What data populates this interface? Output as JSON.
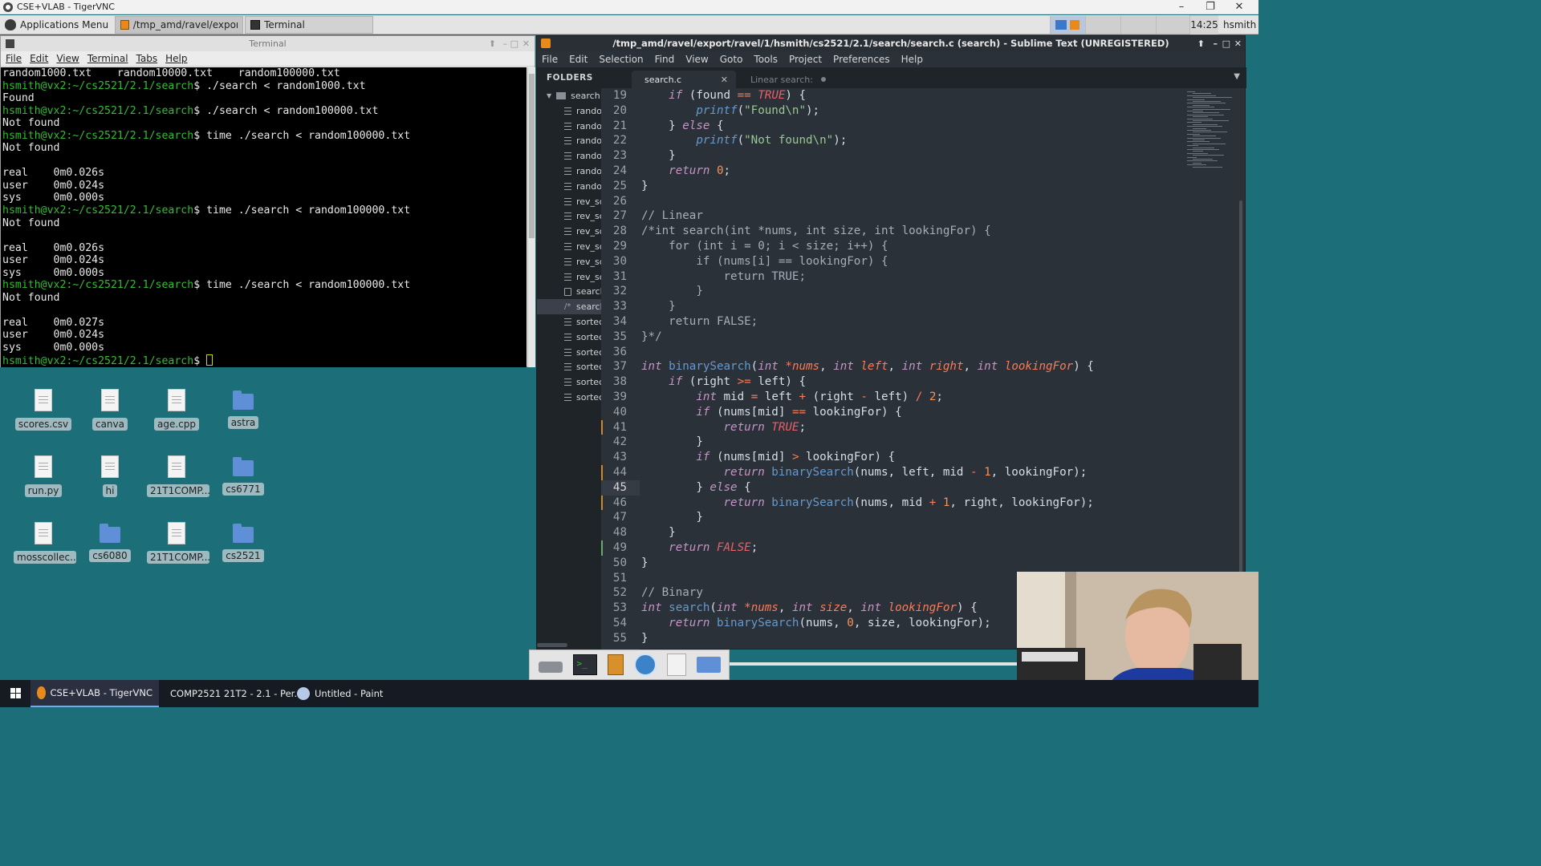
{
  "vnc": {
    "title": "CSE+VLAB - TigerVNC",
    "min": "–",
    "max": "❐",
    "close": "✕"
  },
  "panel": {
    "apps_menu": "Applications Menu",
    "tasks": [
      "/tmp_amd/ravel/export...",
      "Terminal"
    ],
    "clock": "14:25",
    "user": "hsmith"
  },
  "terminal": {
    "title": "Terminal",
    "menu": [
      "File",
      "Edit",
      "View",
      "Terminal",
      "Tabs",
      "Help"
    ],
    "lines": [
      {
        "t": "out",
        "text": "random1000.txt    random10000.txt    random100000.txt"
      },
      {
        "t": "cmd",
        "prompt": "hsmith@vx2:~/cs2521/2.1/search",
        "text": "$ ./search < random1000.txt"
      },
      {
        "t": "out",
        "text": "Found"
      },
      {
        "t": "cmd",
        "prompt": "hsmith@vx2:~/cs2521/2.1/search",
        "text": "$ ./search < random100000.txt"
      },
      {
        "t": "out",
        "text": "Not found"
      },
      {
        "t": "cmd",
        "prompt": "hsmith@vx2:~/cs2521/2.1/search",
        "text": "$ time ./search < random100000.txt"
      },
      {
        "t": "out",
        "text": "Not found"
      },
      {
        "t": "out",
        "text": ""
      },
      {
        "t": "out",
        "text": "real    0m0.026s"
      },
      {
        "t": "out",
        "text": "user    0m0.024s"
      },
      {
        "t": "out",
        "text": "sys     0m0.000s"
      },
      {
        "t": "cmd",
        "prompt": "hsmith@vx2:~/cs2521/2.1/search",
        "text": "$ time ./search < random100000.txt"
      },
      {
        "t": "out",
        "text": "Not found"
      },
      {
        "t": "out",
        "text": ""
      },
      {
        "t": "out",
        "text": "real    0m0.026s"
      },
      {
        "t": "out",
        "text": "user    0m0.024s"
      },
      {
        "t": "out",
        "text": "sys     0m0.000s"
      },
      {
        "t": "cmd",
        "prompt": "hsmith@vx2:~/cs2521/2.1/search",
        "text": "$ time ./search < random100000.txt"
      },
      {
        "t": "out",
        "text": "Not found"
      },
      {
        "t": "out",
        "text": ""
      },
      {
        "t": "out",
        "text": "real    0m0.027s"
      },
      {
        "t": "out",
        "text": "user    0m0.024s"
      },
      {
        "t": "out",
        "text": "sys     0m0.000s"
      },
      {
        "t": "cmd",
        "prompt": "hsmith@vx2:~/cs2521/2.1/search",
        "text": "$ ",
        "cursor": true
      }
    ]
  },
  "desktop": {
    "icons": [
      {
        "label": "scores.csv",
        "kind": "file"
      },
      {
        "label": "canva",
        "kind": "file"
      },
      {
        "label": "age.cpp",
        "kind": "file"
      },
      {
        "label": "astra",
        "kind": "folder"
      },
      {
        "label": "run.py",
        "kind": "file"
      },
      {
        "label": "hi",
        "kind": "file"
      },
      {
        "label": "21T1COMP...",
        "kind": "file"
      },
      {
        "label": "cs6771",
        "kind": "folder"
      },
      {
        "label": "mosscollec...",
        "kind": "file"
      },
      {
        "label": "cs6080",
        "kind": "folder"
      },
      {
        "label": "21T1COMP...",
        "kind": "file"
      },
      {
        "label": "cs2521",
        "kind": "folder"
      }
    ]
  },
  "sublime": {
    "title": "/tmp_amd/ravel/export/ravel/1/hsmith/cs2521/2.1/search/search.c (search) - Sublime Text (UNREGISTERED)",
    "menu": [
      "File",
      "Edit",
      "Selection",
      "Find",
      "View",
      "Goto",
      "Tools",
      "Project",
      "Preferences",
      "Help"
    ],
    "sidebar_header": "FOLDERS",
    "sidebar_arrows": "◀ ▶",
    "folder": "search",
    "files": [
      {
        "name": "rando",
        "icon": "lines"
      },
      {
        "name": "rando",
        "icon": "lines"
      },
      {
        "name": "rando",
        "icon": "lines"
      },
      {
        "name": "rando",
        "icon": "lines"
      },
      {
        "name": "rando",
        "icon": "lines"
      },
      {
        "name": "rando",
        "icon": "lines"
      },
      {
        "name": "rev_sc",
        "icon": "lines"
      },
      {
        "name": "rev_sc",
        "icon": "lines"
      },
      {
        "name": "rev_sc",
        "icon": "lines"
      },
      {
        "name": "rev_sc",
        "icon": "lines"
      },
      {
        "name": "rev_sc",
        "icon": "lines"
      },
      {
        "name": "rev_sc",
        "icon": "lines"
      },
      {
        "name": "searcl",
        "icon": "doc"
      },
      {
        "name": "searcl",
        "icon": "code",
        "selected": true
      },
      {
        "name": "sortec",
        "icon": "lines"
      },
      {
        "name": "sortec",
        "icon": "lines"
      },
      {
        "name": "sortec",
        "icon": "lines"
      },
      {
        "name": "sortec",
        "icon": "lines"
      },
      {
        "name": "sortec",
        "icon": "lines"
      },
      {
        "name": "sortec",
        "icon": "lines"
      }
    ],
    "tabs": [
      {
        "label": "search.c",
        "close": "✕",
        "active": true
      },
      {
        "label": "Linear search:",
        "active": false
      }
    ],
    "current_line": 45,
    "git_marks": {
      "41": "#c98a2e",
      "44": "#c98a2e",
      "46": "#c98a2e",
      "49": "#6aa96a"
    },
    "code_lines": [
      {
        "n": 19,
        "h": "    <span class=\"kw\">if</span> (found <span class=\"op\">==</span> <span class=\"cst\">TRUE</span>) {"
      },
      {
        "n": 20,
        "h": "        <span class=\"fnit\">printf</span>(<span class=\"str\">\"Found\\n\"</span>);"
      },
      {
        "n": 21,
        "h": "    } <span class=\"kw\">else</span> {"
      },
      {
        "n": 22,
        "h": "        <span class=\"fnit\">printf</span>(<span class=\"str\">\"Not found\\n\"</span>);"
      },
      {
        "n": 23,
        "h": "    }"
      },
      {
        "n": 24,
        "h": "    <span class=\"kw\">return</span> <span class=\"num\">0</span>;"
      },
      {
        "n": 25,
        "h": "}"
      },
      {
        "n": 26,
        "h": ""
      },
      {
        "n": 27,
        "h": "<span class=\"cm\">// Linear</span>"
      },
      {
        "n": 28,
        "h": "<span class=\"cm\">/*int search(int *nums, int size, int lookingFor) {</span>"
      },
      {
        "n": 29,
        "h": "<span class=\"cm\">    for (int i = 0; i &lt; size; i++) {</span>"
      },
      {
        "n": 30,
        "h": "<span class=\"cm\">        if (nums[i] == lookingFor) {</span>"
      },
      {
        "n": 31,
        "h": "<span class=\"cm\">            return TRUE;</span>"
      },
      {
        "n": 32,
        "h": "<span class=\"cm\">        }</span>"
      },
      {
        "n": 33,
        "h": "<span class=\"cm\">    }</span>"
      },
      {
        "n": 34,
        "h": "<span class=\"cm\">    return FALSE;</span>"
      },
      {
        "n": 35,
        "h": "<span class=\"cm\">}*/</span>"
      },
      {
        "n": 36,
        "h": ""
      },
      {
        "n": 37,
        "h": "<span class=\"kw\">int</span> <span class=\"fn\">binarySearch</span>(<span class=\"kw\">int</span> <span class=\"op\">*</span><span class=\"par\">nums</span>, <span class=\"kw\">int</span> <span class=\"par\">left</span>, <span class=\"kw\">int</span> <span class=\"par\">right</span>, <span class=\"kw\">int</span> <span class=\"par\">lookingFor</span>) {"
      },
      {
        "n": 38,
        "h": "    <span class=\"kw\">if</span> (right <span class=\"op\">&gt;=</span> left) {"
      },
      {
        "n": 39,
        "h": "        <span class=\"kw\">int</span> mid <span class=\"op\">=</span> left <span class=\"op\">+</span> (right <span class=\"op\">-</span> left) <span class=\"op\">/</span> <span class=\"num\">2</span>;"
      },
      {
        "n": 40,
        "h": "        <span class=\"kw\">if</span> (nums[mid] <span class=\"op\">==</span> lookingFor) {"
      },
      {
        "n": 41,
        "h": "            <span class=\"kw\">return</span> <span class=\"cst\">TRUE</span>;"
      },
      {
        "n": 42,
        "h": "        }"
      },
      {
        "n": 43,
        "h": "        <span class=\"kw\">if</span> (nums[mid] <span class=\"op\">&gt;</span> lookingFor) {"
      },
      {
        "n": 44,
        "h": "            <span class=\"kw\">return</span> <span class=\"fn\">binarySearch</span>(nums, left, mid <span class=\"op\">-</span> <span class=\"num\">1</span>, lookingFor);"
      },
      {
        "n": 45,
        "h": "        } <span class=\"kw\">else</span> {"
      },
      {
        "n": 46,
        "h": "            <span class=\"kw\">return</span> <span class=\"fn\">binarySearch</span>(nums, mid <span class=\"op\">+</span> <span class=\"num\">1</span>, right, lookingFor);"
      },
      {
        "n": 47,
        "h": "        }"
      },
      {
        "n": 48,
        "h": "    }"
      },
      {
        "n": 49,
        "h": "    <span class=\"kw\">return</span> <span class=\"cst\">FALSE</span>;"
      },
      {
        "n": 50,
        "h": "}"
      },
      {
        "n": 51,
        "h": ""
      },
      {
        "n": 52,
        "h": "<span class=\"cm\">// Binary</span>"
      },
      {
        "n": 53,
        "h": "<span class=\"kw\">int</span> <span class=\"fn\">search</span>(<span class=\"kw\">int</span> <span class=\"op\">*</span><span class=\"par\">nums</span>, <span class=\"kw\">int</span> <span class=\"par\">size</span>, <span class=\"kw\">int</span> <span class=\"par\">lookingFor</span>) {"
      },
      {
        "n": 54,
        "h": "    <span class=\"kw\">return</span> <span class=\"fn\">binarySearch</span>(nums, <span class=\"num\">0</span>, size, lookingFor);"
      },
      {
        "n": 55,
        "h": "}"
      }
    ]
  },
  "taskbar": {
    "items": [
      {
        "label": "CSE+VLAB - TigerVNC",
        "active": true,
        "color": "#e8891c"
      },
      {
        "label": "COMP2521 21T2 - 2.1 - Per...",
        "active": false,
        "color": "#1a8fd1"
      },
      {
        "label": "Untitled - Paint",
        "active": false,
        "color": "#b7c9e8"
      }
    ]
  }
}
